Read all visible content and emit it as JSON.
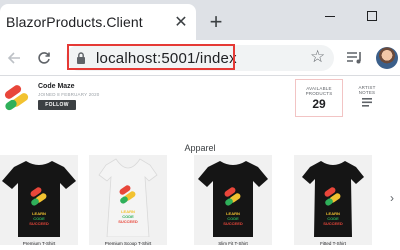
{
  "browser": {
    "tab_title": "BlazorProducts.Client",
    "url": "localhost:5001/index",
    "icons": {
      "close": "close-icon",
      "new_tab": "plus-icon",
      "back": "arrow-left-icon",
      "reload": "reload-icon",
      "lock": "lock-icon",
      "bookmark": "star-icon",
      "media": "media-queue-icon",
      "profile": "avatar"
    },
    "highlight_color": "#e53935"
  },
  "header": {
    "brand_name": "Code Maze",
    "brand_date": "JOINED 8 FEBRUARY 2020",
    "follow_label": "FOLLOW",
    "stats": {
      "available_label": "AVAILABLE PRODUCTS",
      "available_value": "29",
      "notes_label": "ARTIST NOTES"
    }
  },
  "products": {
    "section_title": "Apparel",
    "items": [
      {
        "name": "Premium T-Shirt",
        "shirt_color": "#151515"
      },
      {
        "name": "Premium Scoop T-Shirt",
        "shirt_color": "#f4f4f4"
      },
      {
        "name": "Slim Fit T-Shirt",
        "shirt_color": "#151515"
      },
      {
        "name": "Fitted T-Shirt",
        "shirt_color": "#151515"
      }
    ],
    "print_text": [
      "LEARN",
      "CODE",
      "SUCCEED"
    ],
    "colors": {
      "logo_red": "#e8463a",
      "logo_yellow": "#f2c230",
      "logo_green": "#2fb05a"
    }
  }
}
